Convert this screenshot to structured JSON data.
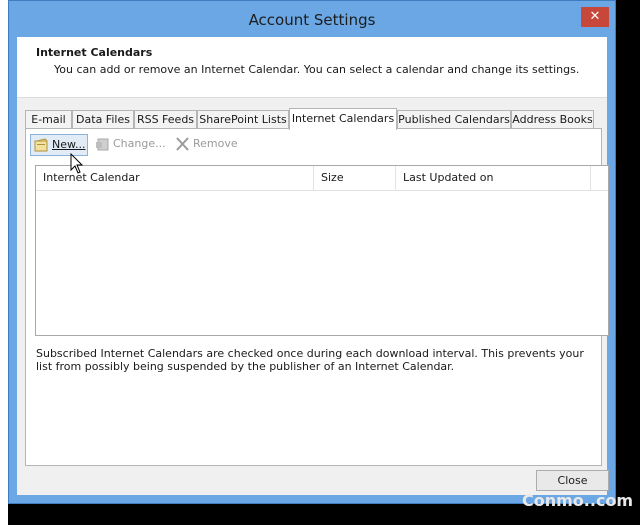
{
  "window": {
    "title": "Account Settings",
    "close_glyph": "✕"
  },
  "header": {
    "title": "Internet Calendars",
    "description": "You can add or remove an Internet Calendar. You can select a calendar and change its settings."
  },
  "tabs": [
    {
      "label": "E-mail"
    },
    {
      "label": "Data Files"
    },
    {
      "label": "RSS Feeds"
    },
    {
      "label": "SharePoint Lists"
    },
    {
      "label": "Internet Calendars",
      "active": true
    },
    {
      "label": "Published Calendars"
    },
    {
      "label": "Address Books"
    }
  ],
  "toolbar": {
    "new_label": "New...",
    "change_label": "Change...",
    "remove_label": "Remove"
  },
  "list": {
    "columns": [
      "Internet Calendar",
      "Size",
      "Last Updated on"
    ],
    "rows": []
  },
  "info_text": "Subscribed Internet Calendars are checked once during each download interval. This prevents your list from possibly being suspended by the publisher of an Internet Calendar.",
  "footer": {
    "close_label": "Close"
  },
  "watermark": {
    "text": "Conmo..com"
  }
}
